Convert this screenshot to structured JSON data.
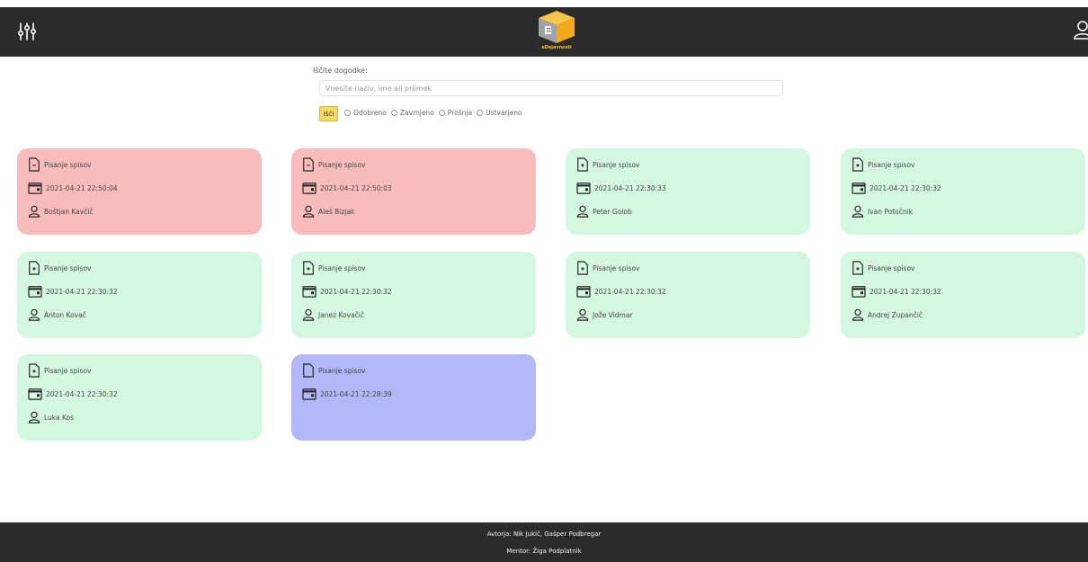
{
  "header": {
    "filter_icon": "sliders-icon",
    "logo_text": "eDejavnosti",
    "user_icon": "user-icon"
  },
  "search": {
    "label": "Iščite dogodke:",
    "placeholder": "Vnesite naziv, ime ali priimek",
    "button_label": "Išči",
    "filters": [
      "Odobreno",
      "Zavrnjeno",
      "Prošnja",
      "Ustvarjeno"
    ]
  },
  "colors": {
    "red": "#f9bcbc",
    "green": "#d3f8df",
    "blue": "#b1b7f7",
    "button": "#f7d95e",
    "bar": "#2b2b2b"
  },
  "events": [
    {
      "title": "Pisanje spisov",
      "datetime": "2021-04-21 22:50:04",
      "person": "Boštjan Kavčič",
      "status": "red",
      "doc_icon": "document-minus-icon"
    },
    {
      "title": "Pisanje spisov",
      "datetime": "2021-04-21 22:50:03",
      "person": "Aleš Bizjak",
      "status": "red",
      "doc_icon": "document-minus-icon"
    },
    {
      "title": "Pisanje spisov",
      "datetime": "2021-04-21 22:30:33",
      "person": "Peter Golob",
      "status": "green",
      "doc_icon": "document-plus-icon"
    },
    {
      "title": "Pisanje spisov",
      "datetime": "2021-04-21 22:30:32",
      "person": "Ivan Potočnik",
      "status": "green",
      "doc_icon": "document-plus-icon"
    },
    {
      "title": "Pisanje spisov",
      "datetime": "2021-04-21 22:30:32",
      "person": "Anton Kovač",
      "status": "green",
      "doc_icon": "document-plus-icon"
    },
    {
      "title": "Pisanje spisov",
      "datetime": "2021-04-21 22:30:32",
      "person": "Janez Kovačič",
      "status": "green",
      "doc_icon": "document-plus-icon"
    },
    {
      "title": "Pisanje spisov",
      "datetime": "2021-04-21 22:30:32",
      "person": "Jože Vidmar",
      "status": "green",
      "doc_icon": "document-plus-icon"
    },
    {
      "title": "Pisanje spisov",
      "datetime": "2021-04-21 22:30:32",
      "person": "Andrej Zupančič",
      "status": "green",
      "doc_icon": "document-plus-icon"
    },
    {
      "title": "Pisanje spisov",
      "datetime": "2021-04-21 22:30:32",
      "person": "Luka Kos",
      "status": "green",
      "doc_icon": "document-plus-icon"
    },
    {
      "title": "Pisanje spisov",
      "datetime": "2021-04-21 22:28:39",
      "person": "",
      "status": "blue",
      "doc_icon": "document-icon"
    }
  ],
  "footer": {
    "authors": "Avtorja: Nik Jukič, Gašper Podbregar",
    "mentor": "Mentor: Žiga Podplatnik"
  }
}
